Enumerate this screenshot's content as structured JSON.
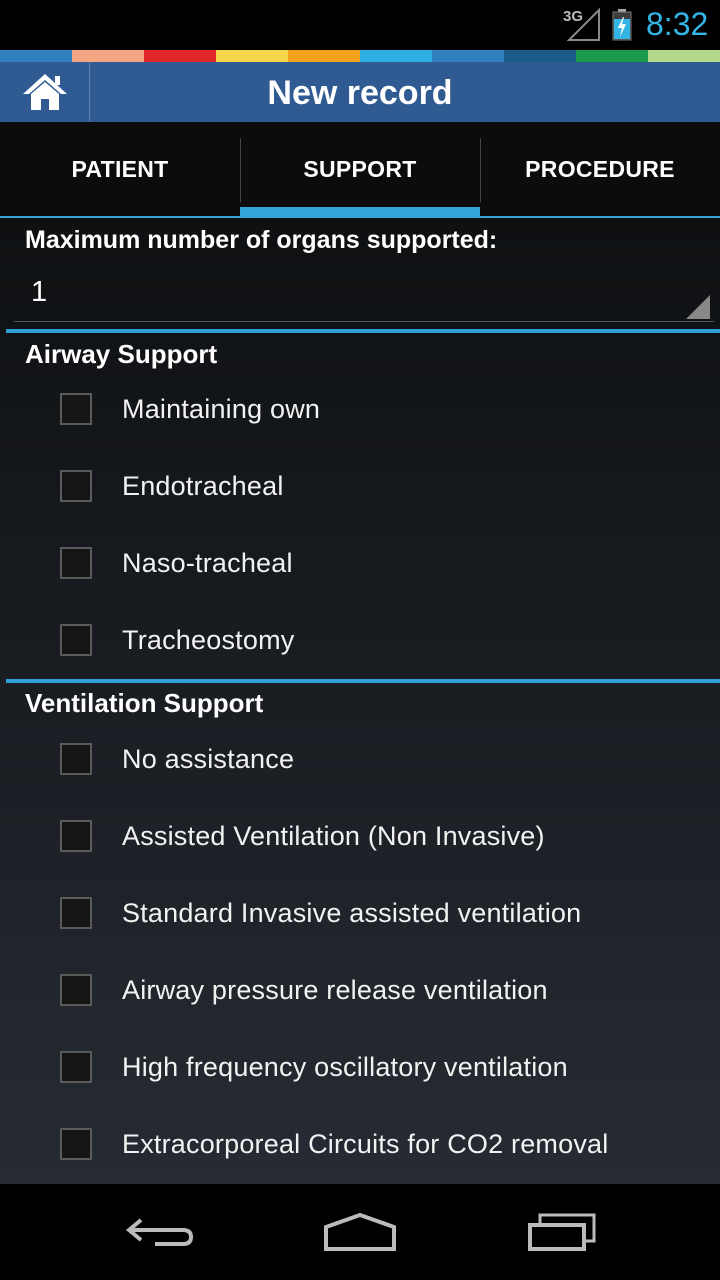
{
  "status_bar": {
    "network": "3G",
    "time": "8:32",
    "icons": [
      "signal-icon",
      "battery-charging-icon"
    ],
    "clock_color": "#33b5e5"
  },
  "color_strip": [
    "#2f7fc1",
    "#f4a582",
    "#e0252b",
    "#f6d64a",
    "#f5a31a",
    "#2faee3",
    "#2f7fc1",
    "#1c5a8a",
    "#1a9a4a",
    "#b4d98a"
  ],
  "action_bar": {
    "title": "New record",
    "home_icon": "home-icon",
    "background": "#2f5a92"
  },
  "tabs": [
    {
      "label": "PATIENT",
      "active": false
    },
    {
      "label": "SUPPORT",
      "active": true
    },
    {
      "label": "PROCEDURE",
      "active": false
    }
  ],
  "accent_color": "#33a4d8",
  "form": {
    "max_organs_label": "Maximum number of organs supported:",
    "max_organs_value": "1",
    "airway": {
      "title": "Airway Support",
      "options": [
        {
          "label": "Maintaining own",
          "checked": false
        },
        {
          "label": "Endotracheal",
          "checked": false
        },
        {
          "label": "Naso-tracheal",
          "checked": false
        },
        {
          "label": "Tracheostomy",
          "checked": false
        }
      ]
    },
    "ventilation": {
      "title": "Ventilation Support",
      "options": [
        {
          "label": "No assistance",
          "checked": false
        },
        {
          "label": "Assisted Ventilation (Non Invasive)",
          "checked": false
        },
        {
          "label": "Standard Invasive assisted ventilation",
          "checked": false
        },
        {
          "label": "Airway pressure release ventilation",
          "checked": false
        },
        {
          "label": "High frequency oscillatory ventilation",
          "checked": false
        },
        {
          "label": "Extracorporeal Circuits for CO2 removal",
          "checked": false
        }
      ]
    }
  },
  "nav_bar": {
    "buttons": [
      "back-icon",
      "home-nav-icon",
      "recent-apps-icon"
    ]
  }
}
